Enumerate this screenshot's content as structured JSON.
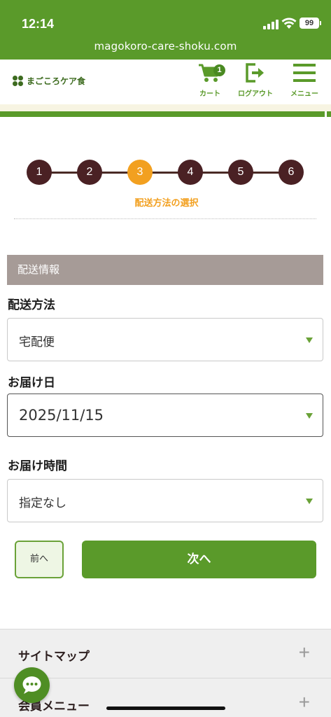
{
  "status_bar": {
    "time": "12:14",
    "battery": "99"
  },
  "browser": {
    "url": "magokoro-care-shoku.com"
  },
  "header": {
    "logo_text": "まごころケア食",
    "cart_label": "カート",
    "cart_count": "1",
    "logout_label": "ログアウト",
    "menu_label": "メニュー"
  },
  "steps": {
    "items": [
      "1",
      "2",
      "3",
      "4",
      "5",
      "6"
    ],
    "active_index": 2,
    "active_caption": "配送方法の選択"
  },
  "form": {
    "section_title": "配送情報",
    "delivery_method": {
      "label": "配送方法",
      "value": "宅配便"
    },
    "delivery_date": {
      "label": "お届け日",
      "value": "2025/11/15"
    },
    "delivery_time": {
      "label": "お届け時間",
      "value": "指定なし"
    }
  },
  "buttons": {
    "prev": "前へ",
    "next": "次へ"
  },
  "footer": {
    "items": [
      {
        "label": "サイトマップ"
      },
      {
        "label": "会員メニュー"
      }
    ]
  },
  "colors": {
    "brand_green": "#5a9a2a",
    "active_step": "#f2a020",
    "step_dark": "#4a2124",
    "section_gray": "#a69b97"
  }
}
